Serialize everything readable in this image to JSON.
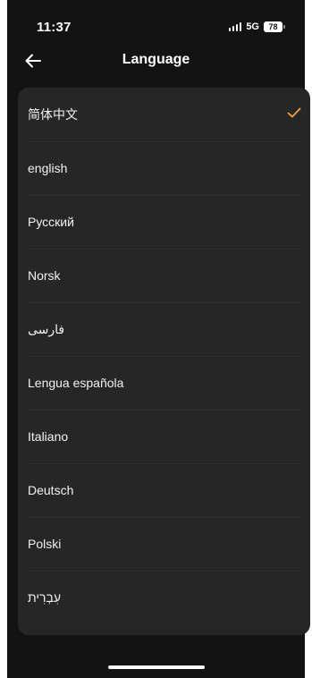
{
  "status_bar": {
    "time": "11:37",
    "network": "5G",
    "battery": "78"
  },
  "header": {
    "back_icon": "arrow-left-icon",
    "title": "Language"
  },
  "languages": [
    {
      "label": "简体中文",
      "selected": true
    },
    {
      "label": "english",
      "selected": false
    },
    {
      "label": "Русский",
      "selected": false
    },
    {
      "label": "Norsk",
      "selected": false
    },
    {
      "label": "فارسی",
      "selected": false
    },
    {
      "label": "Lengua española",
      "selected": false
    },
    {
      "label": "Italiano",
      "selected": false
    },
    {
      "label": "Deutsch",
      "selected": false
    },
    {
      "label": "Polski",
      "selected": false
    },
    {
      "label": "עִבְרִית",
      "selected": false
    }
  ],
  "colors": {
    "background": "#131313",
    "card": "#262626",
    "accent": "#f5a03a"
  }
}
